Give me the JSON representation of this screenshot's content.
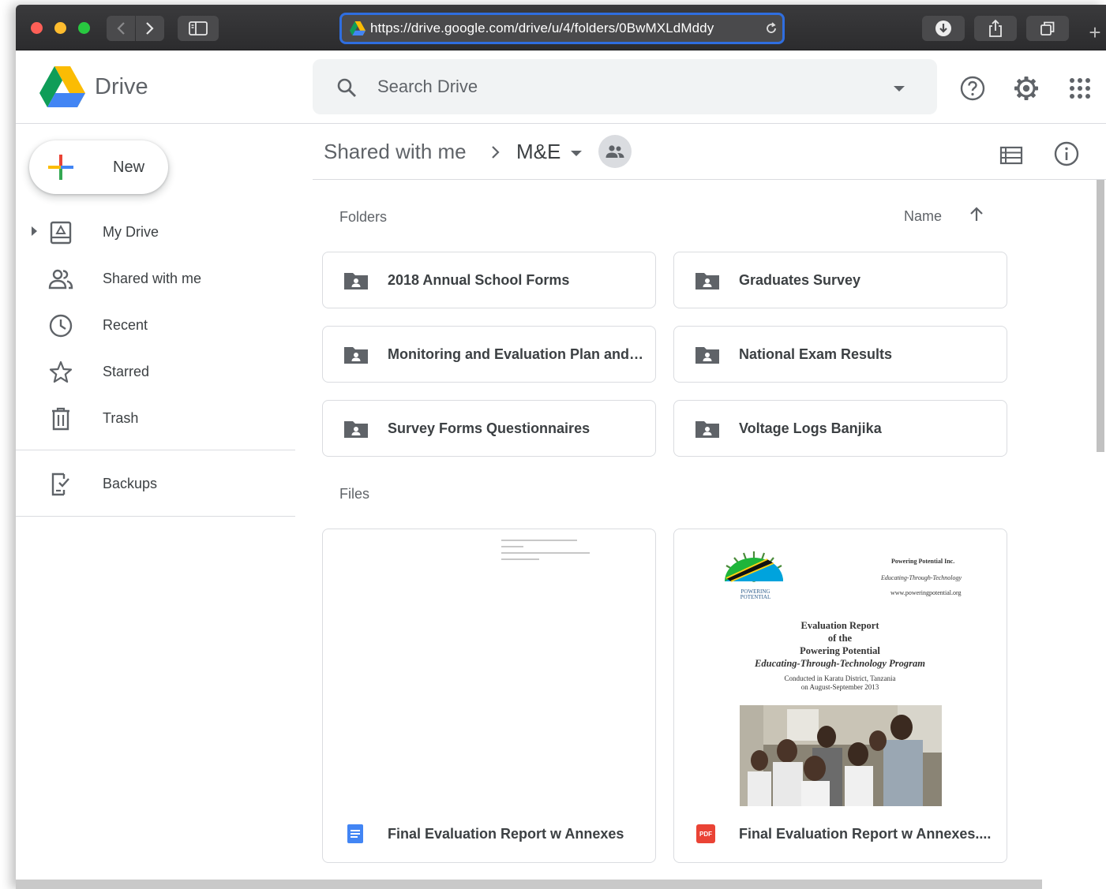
{
  "browser": {
    "url": "https://drive.google.com/drive/u/4/folders/0BwMXLdMddy",
    "new_tab_label": "+"
  },
  "header": {
    "brand": "Drive",
    "search_placeholder": "Search Drive"
  },
  "sidebar": {
    "new_label": "New",
    "items": [
      {
        "label": "My Drive",
        "icon": "my-drive-icon"
      },
      {
        "label": "Shared with me",
        "icon": "people-icon"
      },
      {
        "label": "Recent",
        "icon": "clock-icon"
      },
      {
        "label": "Starred",
        "icon": "star-icon"
      },
      {
        "label": "Trash",
        "icon": "trash-icon"
      },
      {
        "label": "Backups",
        "icon": "backup-device-icon"
      }
    ]
  },
  "breadcrumb": {
    "root": "Shared with me",
    "current": "M&E"
  },
  "folders_section": {
    "label": "Folders",
    "sort_label": "Name",
    "items": [
      {
        "name": "2018 Annual School Forms"
      },
      {
        "name": "Graduates Survey"
      },
      {
        "name": "Monitoring and Evaluation Plan and ..."
      },
      {
        "name": "National Exam Results"
      },
      {
        "name": "Survey Forms Questionnaires"
      },
      {
        "name": "Voltage Logs Banjika"
      }
    ]
  },
  "files_section": {
    "label": "Files",
    "items": [
      {
        "name": "Final Evaluation Report w Annexes",
        "type": "google-doc"
      },
      {
        "name": "Final Evaluation Report w Annexes....",
        "type": "pdf"
      }
    ]
  },
  "pdf_preview": {
    "org_lines": [
      "Powering Potential Inc.",
      "Educating-Through-Technology",
      "www.poweringpotential.org"
    ],
    "logo_text": "POWERING POTENTIAL",
    "title_lines": [
      "Evaluation Report",
      "of the",
      "Powering Potential",
      "Educating-Through-Technology Program"
    ],
    "subtitle_lines": [
      "Conducted in Karatu District, Tanzania",
      "on August-September 2013"
    ],
    "badge": "PDF"
  },
  "colors": {
    "accent_blue": "#2f6ee0",
    "doc_blue": "#4285f4",
    "pdf_red": "#ea4335",
    "folder_gray": "#5f6368"
  }
}
